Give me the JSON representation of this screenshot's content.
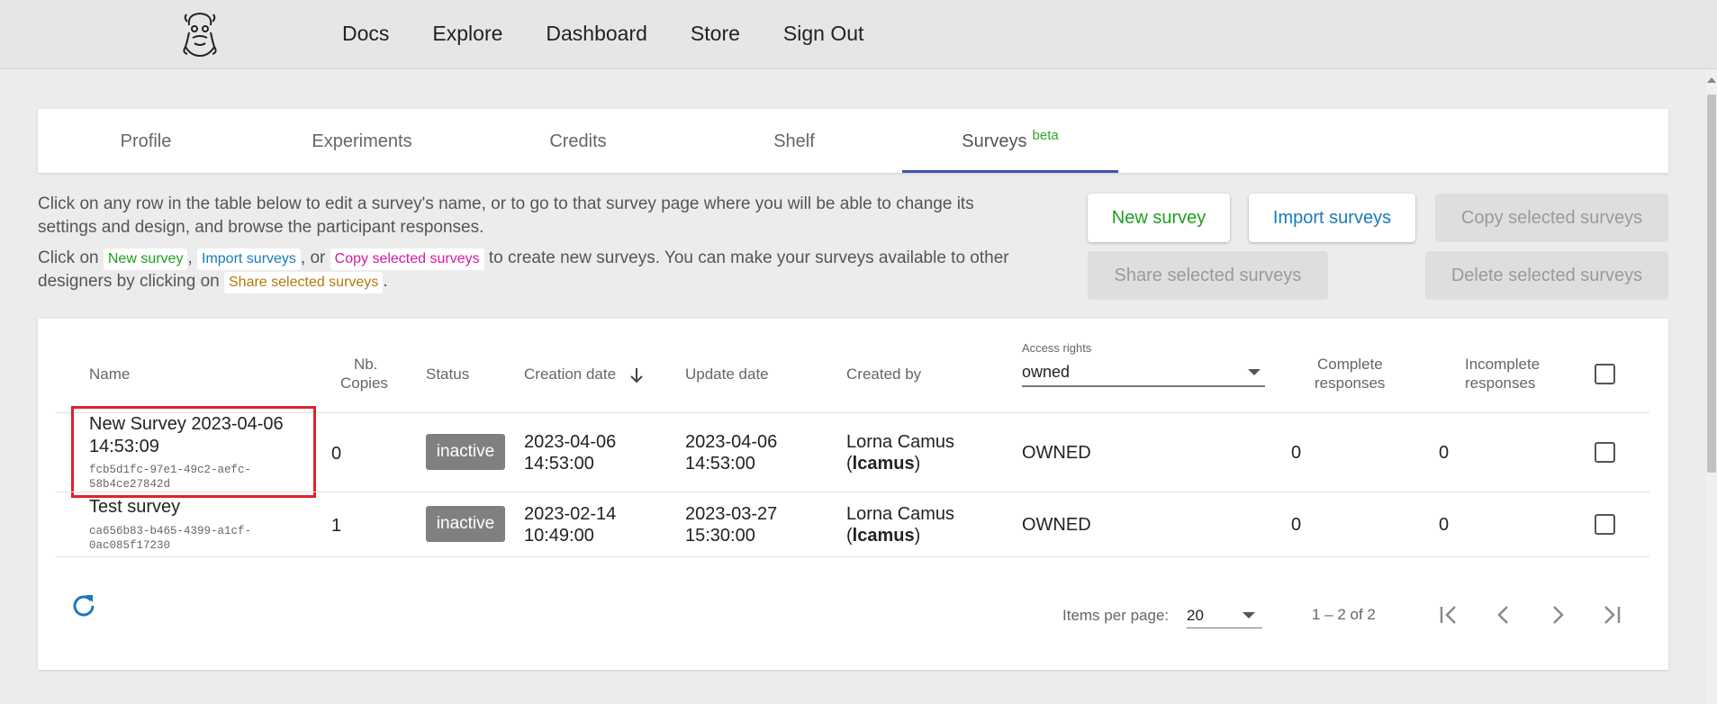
{
  "nav": {
    "logo": "bearded-face-logo",
    "links": [
      "Docs",
      "Explore",
      "Dashboard",
      "Store",
      "Sign Out"
    ]
  },
  "tabs": {
    "items": [
      {
        "label": "Profile"
      },
      {
        "label": "Experiments"
      },
      {
        "label": "Credits"
      },
      {
        "label": "Shelf"
      },
      {
        "label": "Surveys",
        "badge": "beta"
      }
    ],
    "active": "Surveys"
  },
  "description": {
    "line1": "Click on any row in the table below to edit a survey's name, or to go to that survey page where you will be able to change its settings and design, and browse the participant responses.",
    "line2_prefix": "Click on",
    "chip_new": "New survey",
    "sep1": ",",
    "chip_import": "Import surveys",
    "sep2": ", or",
    "chip_copy": "Copy selected surveys",
    "line2_middle": "to create new surveys. You can make your surveys available to other designers by clicking on",
    "chip_share": "Share selected surveys",
    "line2_end": "."
  },
  "actions": {
    "new_survey": "New survey",
    "import_surveys": "Import surveys",
    "copy_selected": "Copy selected surveys",
    "share_selected": "Share selected surveys",
    "delete_selected": "Delete selected surveys"
  },
  "table": {
    "headers": {
      "name": "Name",
      "copies_1": "Nb.",
      "copies_2": "Copies",
      "status": "Status",
      "creation": "Creation date",
      "update": "Update date",
      "created_by": "Created by",
      "access_label": "Access rights",
      "access_value": "owned",
      "complete_1": "Complete",
      "complete_2": "responses",
      "incomplete_1": "Incomplete",
      "incomplete_2": "responses"
    },
    "rows": [
      {
        "name_1": "New Survey 2023-04-06",
        "name_2": "14:53:09",
        "id_1": "fcb5d1fc-97e1-49c2-aefc-",
        "id_2": "58b4ce27842d",
        "copies": "0",
        "status": "inactive",
        "created_1": "2023-04-06",
        "created_2": "14:53:00",
        "updated_1": "2023-04-06",
        "updated_2": "14:53:00",
        "author_name": "Lorna Camus",
        "author_handle": "lcamus",
        "access": "OWNED",
        "complete": "0",
        "incomplete": "0"
      },
      {
        "name_1": "Test survey",
        "id_1": "ca656b83-b465-4399-a1cf-",
        "id_2": "0ac085f17230",
        "copies": "1",
        "status": "inactive",
        "created_1": "2023-02-14",
        "created_2": "10:49:00",
        "updated_1": "2023-03-27",
        "updated_2": "15:30:00",
        "author_name": "Lorna Camus",
        "author_handle": "lcamus",
        "access": "OWNED",
        "complete": "0",
        "incomplete": "0"
      }
    ]
  },
  "paginator": {
    "items_per_page_label": "Items per page:",
    "items_per_page": "20",
    "range": "1 – 2 of 2"
  },
  "colors": {
    "accent": "#3f51b5",
    "new_survey": "#1e9e1e",
    "import": "#1a7bb5",
    "badge": "#808080",
    "highlight": "#e3202a"
  }
}
